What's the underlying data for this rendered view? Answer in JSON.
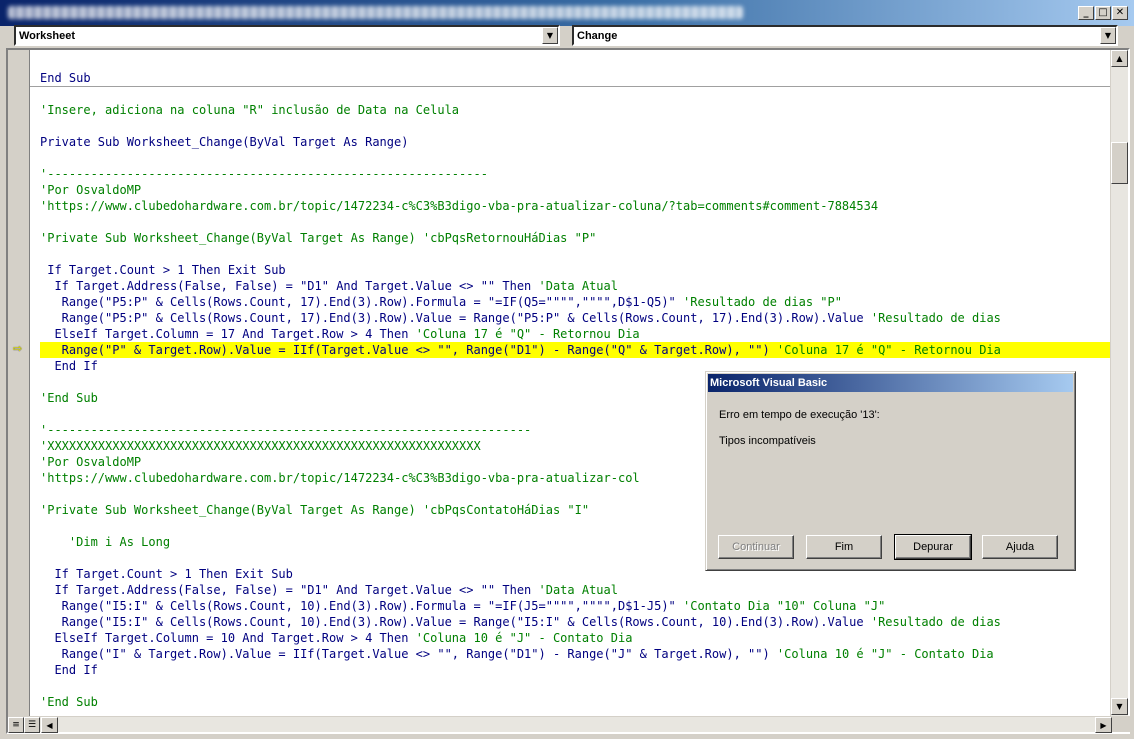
{
  "window": {
    "title": "",
    "minimize_glyph": "_",
    "maximize_glyph": "□",
    "close_glyph": "✕"
  },
  "object_combo": {
    "value": "Worksheet"
  },
  "procedure_combo": {
    "value": "Change"
  },
  "code_lines": [
    [
      {
        "t": "End Sub",
        "s": "k"
      }
    ],
    [],
    [
      {
        "t": "'Insere, adiciona na coluna \"R\" inclusão de Data na Celula",
        "s": "c"
      }
    ],
    [],
    [
      {
        "t": "Private Sub Worksheet_Change(ByVal Target As Range)",
        "s": "k"
      }
    ],
    [],
    [
      {
        "t": "'-------------------------------------------------------------",
        "s": "c"
      }
    ],
    [
      {
        "t": "'Por OsvaldoMP",
        "s": "c"
      }
    ],
    [
      {
        "t": "'https://www.clubedohardware.com.br/topic/1472234-c%C3%B3digo-vba-pra-atualizar-coluna/?tab=comments#comment-7884534",
        "s": "c"
      }
    ],
    [],
    [
      {
        "t": "'Private Sub Worksheet_Change(ByVal Target As Range) 'cbPqsRetornouHáDias \"P\"",
        "s": "c"
      }
    ],
    [],
    [
      {
        "t": " If Target.Count > 1 Then Exit Sub",
        "s": "k"
      }
    ],
    [
      {
        "t": "  If Target.Address(False, False) = \"D1\" And Target.Value <> \"\" Then ",
        "s": "k"
      },
      {
        "t": "'Data Atual",
        "s": "c"
      }
    ],
    [
      {
        "t": "   Range(\"P5:P\" & Cells(Rows.Count, 17).End(3).Row).Formula = \"=IF(Q5=\"\"\"\",\"\"\"\",D$1-Q5)\" ",
        "s": "k"
      },
      {
        "t": "'Resultado de dias \"P\"",
        "s": "c"
      }
    ],
    [
      {
        "t": "   Range(\"P5:P\" & Cells(Rows.Count, 17).End(3).Row).Value = Range(\"P5:P\" & Cells(Rows.Count, 17).End(3).Row).Value ",
        "s": "k"
      },
      {
        "t": "'Resultado de dias",
        "s": "c"
      }
    ],
    [
      {
        "t": "  ElseIf Target.Column = 17 And Target.Row > 4 Then ",
        "s": "k"
      },
      {
        "t": "'Coluna 17 é \"Q\" - Retornou Dia",
        "s": "c"
      }
    ],
    [
      {
        "t": "   Range(\"P\" & Target.Row).Value = IIf(Target.Value <> \"\", Range(\"D1\") - Range(\"Q\" & Target.Row), \"\") ",
        "s": "k"
      },
      {
        "t": "'Coluna 17 é \"Q\" - Retornou Dia",
        "s": "c"
      }
    ],
    [
      {
        "t": "  End If",
        "s": "k"
      }
    ],
    [],
    [
      {
        "t": "'End Sub",
        "s": "c"
      }
    ],
    [],
    [
      {
        "t": "'-------------------------------------------------------------------",
        "s": "c"
      }
    ],
    [
      {
        "t": "'XXXXXXXXXXXXXXXXXXXXXXXXXXXXXXXXXXXXXXXXXXXXXXXXXXXXXXXXXXXX",
        "s": "c"
      }
    ],
    [
      {
        "t": "'Por OsvaldoMP",
        "s": "c"
      }
    ],
    [
      {
        "t": "'https://www.clubedohardware.com.br/topic/1472234-c%C3%B3digo-vba-pra-atualizar-col",
        "s": "c"
      }
    ],
    [],
    [
      {
        "t": "'Private Sub Worksheet_Change(ByVal Target As Range) 'cbPqsContatoHáDias \"I\"",
        "s": "c"
      }
    ],
    [],
    [
      {
        "t": "    'Dim i As Long",
        "s": "c"
      }
    ],
    [],
    [
      {
        "t": "  If Target.Count > 1 Then Exit Sub",
        "s": "k"
      }
    ],
    [
      {
        "t": "  If Target.Address(False, False) = \"D1\" And Target.Value <> \"\" Then ",
        "s": "k"
      },
      {
        "t": "'Data Atual",
        "s": "c"
      }
    ],
    [
      {
        "t": "   Range(\"I5:I\" & Cells(Rows.Count, 10).End(3).Row).Formula = \"=IF(J5=\"\"\"\",\"\"\"\",D$1-J5)\" ",
        "s": "k"
      },
      {
        "t": "'Contato Dia \"10\" Coluna \"J\"",
        "s": "c"
      }
    ],
    [
      {
        "t": "   Range(\"I5:I\" & Cells(Rows.Count, 10).End(3).Row).Value = Range(\"I5:I\" & Cells(Rows.Count, 10).End(3).Row).Value ",
        "s": "k"
      },
      {
        "t": "'Resultado de dias",
        "s": "c"
      }
    ],
    [
      {
        "t": "  ElseIf Target.Column = 10 And Target.Row > 4 Then ",
        "s": "k"
      },
      {
        "t": "'Coluna 10 é \"J\" - Contato Dia",
        "s": "c"
      }
    ],
    [
      {
        "t": "   Range(\"I\" & Target.Row).Value = IIf(Target.Value <> \"\", Range(\"D1\") - Range(\"J\" & Target.Row), \"\") ",
        "s": "k"
      },
      {
        "t": "'Coluna 10 é \"J\" - Contato Dia",
        "s": "c"
      }
    ],
    [
      {
        "t": "  End If",
        "s": "k"
      }
    ],
    [],
    [
      {
        "t": "'End Sub",
        "s": "c"
      }
    ]
  ],
  "highlighted_line_index": 17,
  "dialog": {
    "title": "Microsoft Visual Basic",
    "error_line": "Erro em tempo de execução '13':",
    "message": "Tipos incompatíveis",
    "buttons": {
      "continue": "Continuar",
      "end": "Fim",
      "debug": "Depurar",
      "help": "Ajuda"
    }
  },
  "colors": {
    "comment": "#008000",
    "keyword": "#000080",
    "highlight": "#ffff00"
  },
  "icons": {
    "execution_pointer": "arrow-right-icon",
    "scroll_up": "triangle-up-icon",
    "scroll_down": "triangle-down-icon",
    "scroll_left": "triangle-left-icon",
    "scroll_right": "triangle-right-icon",
    "procedure_view": "procedure-view-icon",
    "full_module_view": "full-module-view-icon",
    "combo_dropdown": "chevron-down-icon"
  }
}
